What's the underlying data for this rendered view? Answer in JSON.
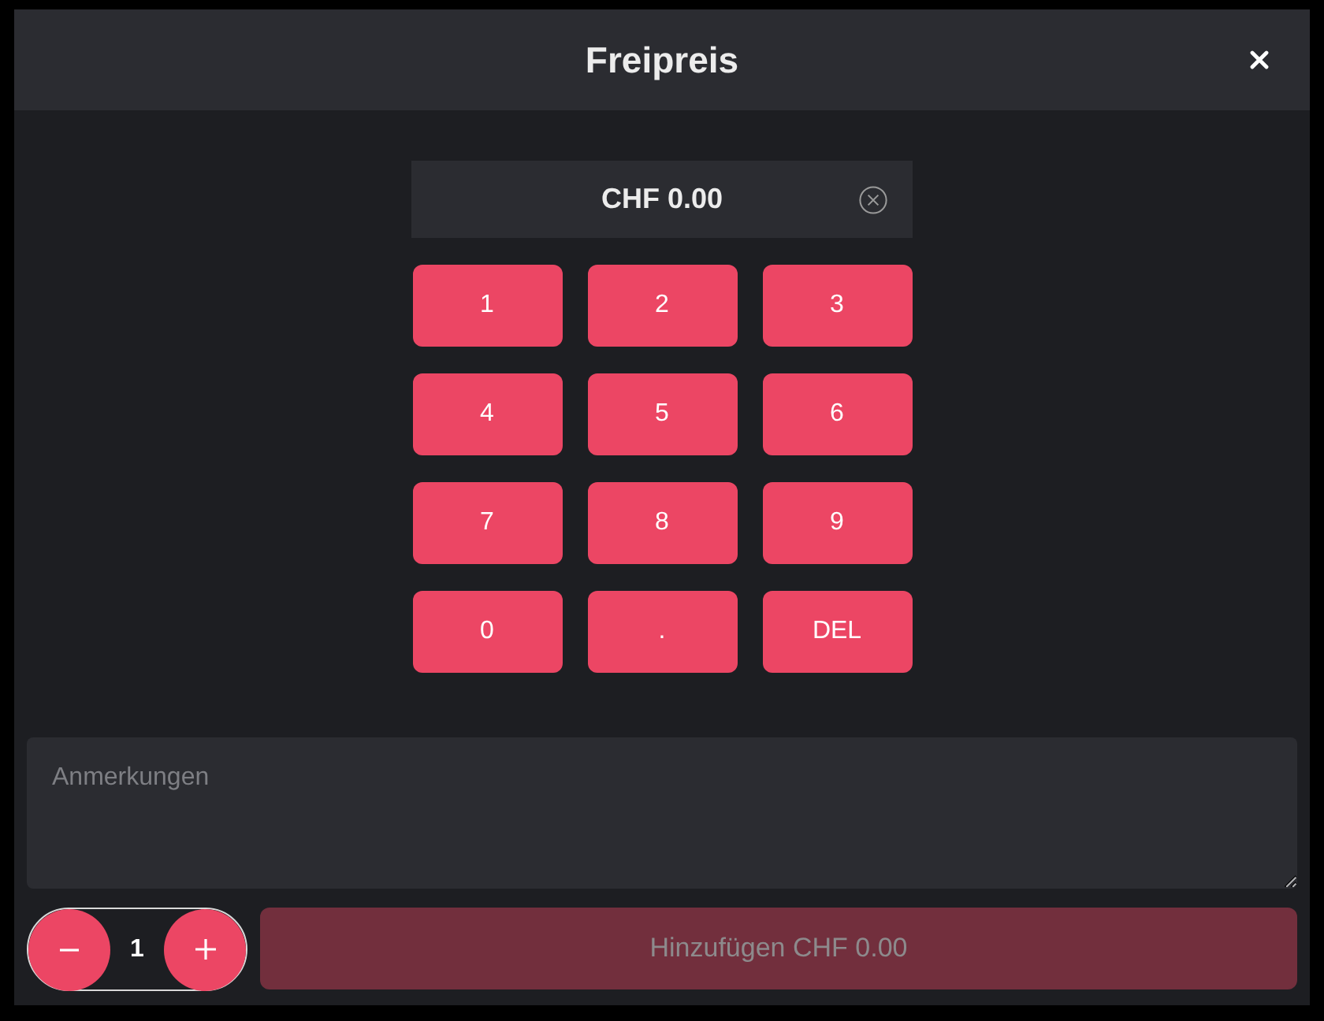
{
  "dialog": {
    "title": "Freipreis"
  },
  "display": {
    "value": "CHF 0.00"
  },
  "keypad": {
    "keys": [
      "1",
      "2",
      "3",
      "4",
      "5",
      "6",
      "7",
      "8",
      "9",
      "0",
      ".",
      "DEL"
    ]
  },
  "notes": {
    "placeholder": "Anmerkungen"
  },
  "quantity": {
    "value": "1"
  },
  "add_button": {
    "label": "Hinzufügen CHF 0.00",
    "disabled": true
  }
}
